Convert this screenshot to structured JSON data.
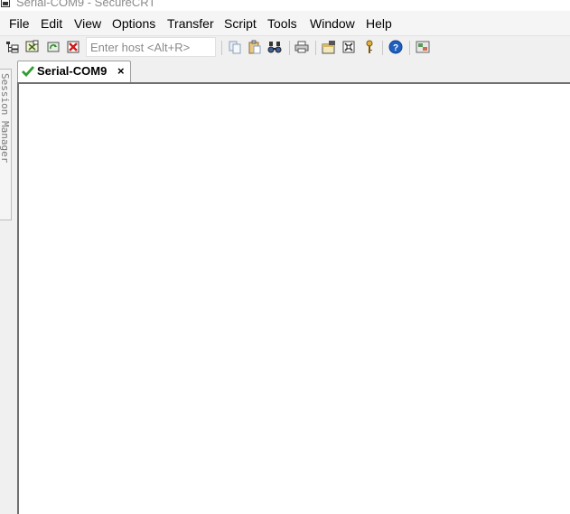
{
  "window": {
    "title": "Serial-COM9 - SecureCRT"
  },
  "menu": {
    "items": [
      {
        "label": "File"
      },
      {
        "label": "Edit"
      },
      {
        "label": "View"
      },
      {
        "label": "Options"
      },
      {
        "label": "Transfer"
      },
      {
        "label": "Script"
      },
      {
        "label": "Tools"
      },
      {
        "label": "Window"
      },
      {
        "label": "Help"
      }
    ]
  },
  "toolbar": {
    "host_placeholder": "Enter host <Alt+R>",
    "icons": [
      "connect-in-tab-icon",
      "quick-connect-icon",
      "reconnect-icon",
      "disconnect-icon",
      "copy-icon",
      "paste-icon",
      "find-icon",
      "print-icon",
      "session-options-icon",
      "global-options-icon",
      "keymap-icon",
      "help-icon",
      "sftp-icon"
    ]
  },
  "side_panel": {
    "label": "Session Manager"
  },
  "tabs": [
    {
      "label": "Serial-COM9",
      "close": "×",
      "status": "connected"
    }
  ],
  "colors": {
    "connected_check": "#2e9e2e",
    "help_blue": "#1f5fbf"
  }
}
